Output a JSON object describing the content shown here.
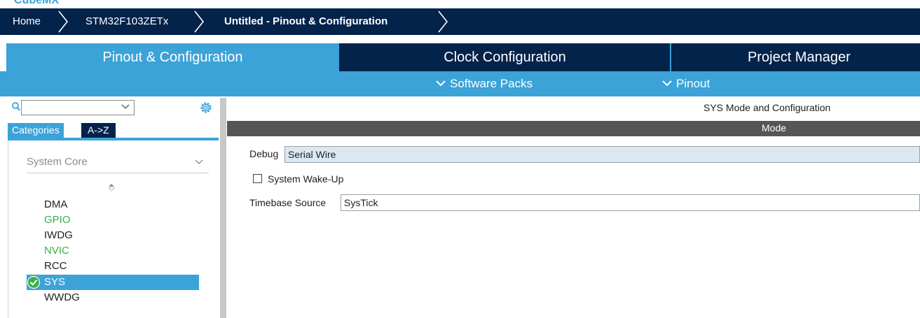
{
  "app": {
    "logo_text": "CubeMX"
  },
  "breadcrumb": {
    "items": [
      "Home",
      "STM32F103ZETx",
      "Untitled - Pinout & Configuration"
    ]
  },
  "tabs": [
    {
      "label": "Pinout & Configuration",
      "active": true
    },
    {
      "label": "Clock Configuration",
      "active": false
    },
    {
      "label": "Project Manager",
      "active": false
    }
  ],
  "subbar": {
    "software_packs": "Software Packs",
    "pinout": "Pinout"
  },
  "left_panel": {
    "search_value": "",
    "tabs": {
      "categories": "Categories",
      "az": "A->Z"
    },
    "category_selected": "System Core",
    "items": [
      {
        "label": "DMA",
        "state": "normal"
      },
      {
        "label": "GPIO",
        "state": "green"
      },
      {
        "label": "IWDG",
        "state": "normal"
      },
      {
        "label": "NVIC",
        "state": "green"
      },
      {
        "label": "RCC",
        "state": "normal"
      },
      {
        "label": "SYS",
        "state": "selected"
      },
      {
        "label": "WWDG",
        "state": "normal"
      }
    ]
  },
  "right_panel": {
    "title": "SYS Mode and Configuration",
    "mode_header": "Mode",
    "debug_label": "Debug",
    "debug_value": "Serial Wire",
    "wakeup_label": "System Wake-Up",
    "wakeup_checked": false,
    "timebase_label": "Timebase Source",
    "timebase_value": "SysTick"
  },
  "colors": {
    "navy": "#03234b",
    "accent_blue": "#3ba3d8",
    "green": "#36b24a",
    "mode_bar": "#555555"
  }
}
